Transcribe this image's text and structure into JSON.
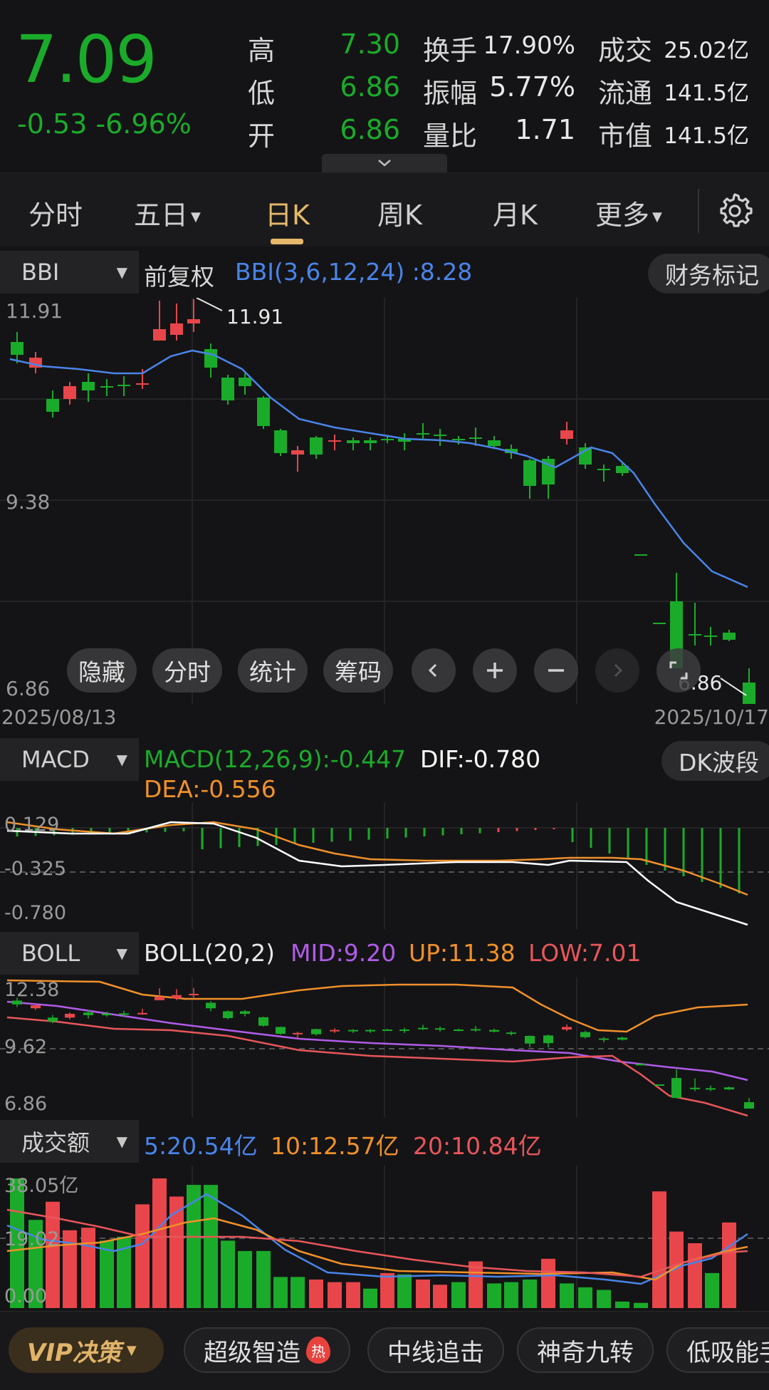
{
  "quote": {
    "price": "7.09",
    "change": "-0.53 -6.96%",
    "rows": [
      {
        "l1": "高",
        "v1": "7.30",
        "l2": "换手",
        "v2": "17.90%",
        "l3": "成交",
        "v3": "25.02亿"
      },
      {
        "l1": "低",
        "v1": "6.86",
        "l2": "振幅",
        "v2": "5.77%",
        "l3": "流通",
        "v3": "141.5亿"
      },
      {
        "l1": "开",
        "v1": "6.86",
        "l2": "量比",
        "v2": "1.71",
        "l3": "市值",
        "v3": "141.5亿"
      }
    ]
  },
  "tabs": {
    "fenshi": "分时",
    "wuri": "五日",
    "rik": "日K",
    "zhouk": "周K",
    "yuek": "月K",
    "more": "更多"
  },
  "main_chart": {
    "indicator": "BBI",
    "adjust": "前复权",
    "formula": "BBI(3,6,12,24)  :8.28",
    "right_button": "财务标记",
    "y_top": "11.91",
    "y_mid": "9.38",
    "y_bottom": "6.86",
    "high_mark": "11.91",
    "low_mark": "6.86",
    "date_start": "2025/08/13",
    "date_end": "2025/10/17",
    "overlay": {
      "hide": "隐藏",
      "fenshi": "分时",
      "stats": "统计",
      "chips": "筹码"
    }
  },
  "macd": {
    "indicator": "MACD",
    "formula": "MACD(12,26,9):-0.447",
    "dif": "DIF:-0.780",
    "dea": "DEA:-0.556",
    "right_button": "DK波段",
    "y_top": "0.129",
    "y_mid": "-0.325",
    "y_bottom": "-0.780"
  },
  "boll": {
    "indicator": "BOLL",
    "formula": "BOLL(20,2)",
    "mid": "MID:9.20",
    "up": "UP:11.38",
    "low": "LOW:7.01",
    "y_top": "12.38",
    "y_mid": "9.62",
    "y_bottom": "6.86"
  },
  "volume": {
    "indicator": "成交额",
    "ma5": "5:20.54亿",
    "ma10": "10:12.57亿",
    "ma20": "20:10.84亿",
    "y_top": "38.05亿",
    "y_mid": "19.02",
    "y_bottom": "0.00"
  },
  "bottom": {
    "vip": "VIP决策",
    "item1": "超级智造",
    "hot": "热",
    "item2": "中线追击",
    "item3": "神奇九转",
    "item4": "低吸能手"
  },
  "colors": {
    "up": "#e8464a",
    "down": "#1bab2a",
    "bbi": "#4a84e8",
    "accent": "#e6b86a"
  }
}
